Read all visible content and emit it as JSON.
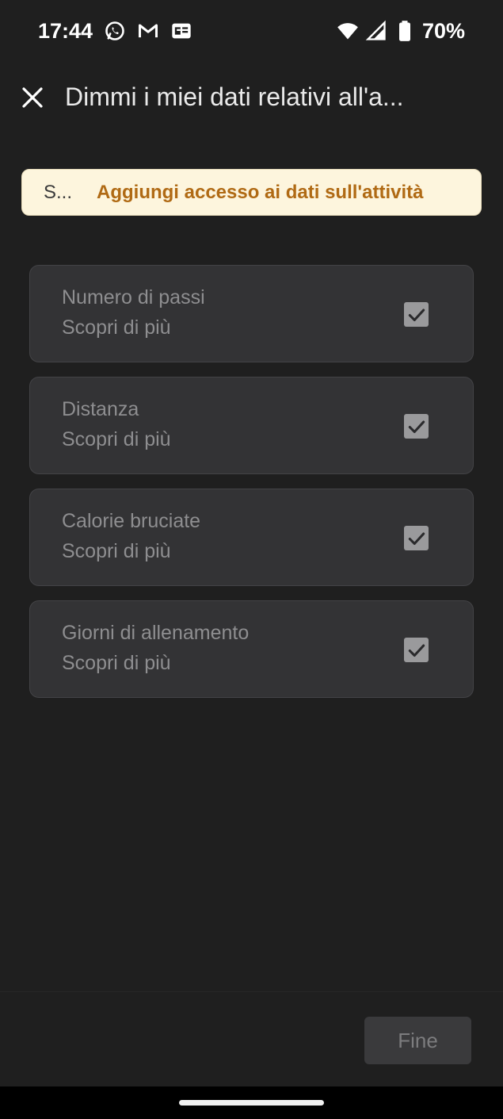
{
  "status_bar": {
    "time": "17:44",
    "battery": "70%",
    "notification_icons": [
      "whatsapp-icon",
      "gmail-icon",
      "news-icon"
    ],
    "system_icons": [
      "wifi-icon",
      "signal-icon",
      "battery-icon"
    ]
  },
  "header": {
    "title": "Dimmi i miei dati relativi all'a...",
    "close_icon": "close-icon"
  },
  "banner": {
    "short_text": "S...",
    "action": "Aggiungi accesso ai dati sull'attività",
    "background": "#fdf5dd",
    "accent": "#b06a14"
  },
  "items": [
    {
      "title": "Numero di passi",
      "link": "Scopri di più",
      "checked": true
    },
    {
      "title": "Distanza",
      "link": "Scopri di più",
      "checked": true
    },
    {
      "title": "Calorie bruciate",
      "link": "Scopri di più",
      "checked": true
    },
    {
      "title": "Giorni di allenamento",
      "link": "Scopri di più",
      "checked": true
    }
  ],
  "footer": {
    "done_label": "Fine"
  },
  "colors": {
    "background": "#1f1f1f",
    "card": "#333335",
    "checkbox": "#9a9a9c"
  }
}
